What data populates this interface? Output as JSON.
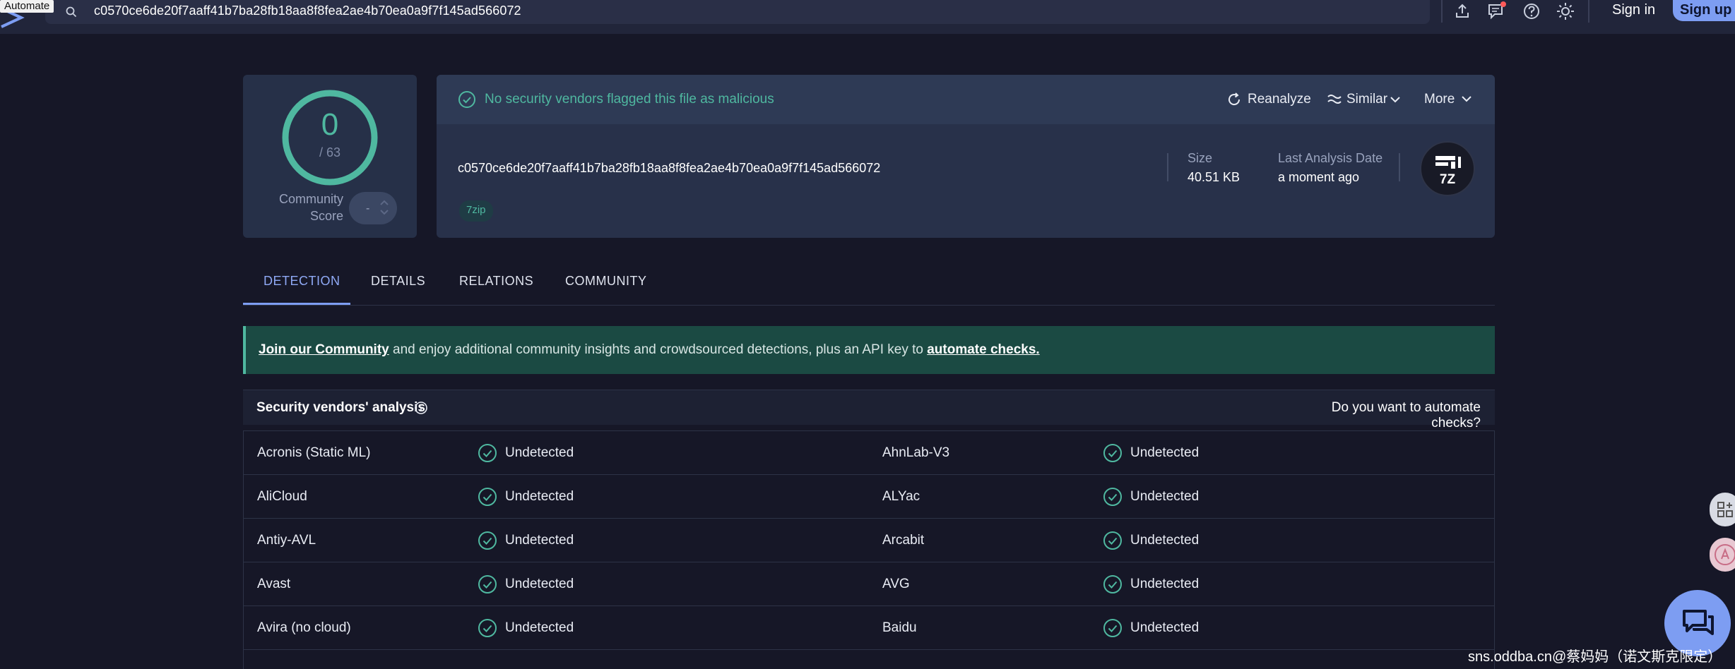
{
  "topbar": {
    "automate_tag": "Automate",
    "search_value": "c0570ce6de20f7aaff41b7ba28fb18aa8f8fea2ae4b70ea0a9f7f145ad566072",
    "signin_label": "Sign in",
    "signup_label": "Sign up"
  },
  "score": {
    "value": "0",
    "total": "/ 63",
    "community_label_line1": "Community",
    "community_label_line2": "Score",
    "community_value": "-"
  },
  "header": {
    "status_text": "No security vendors flagged this file as malicious",
    "reanalyze_label": "Reanalyze",
    "similar_label": "Similar",
    "more_label": "More",
    "file_hash": "c0570ce6de20f7aaff41b7ba28fb18aa8f8fea2ae4b70ea0a9f7f145ad566072",
    "tag": "7zip",
    "size_label": "Size",
    "size_value": "40.51 KB",
    "date_label": "Last Analysis Date",
    "date_value": "a moment ago",
    "file_type_icon_text": "7Z"
  },
  "tabs": [
    {
      "label": "DETECTION",
      "active": true
    },
    {
      "label": "DETAILS",
      "active": false
    },
    {
      "label": "RELATIONS",
      "active": false
    },
    {
      "label": "COMMUNITY",
      "active": false
    }
  ],
  "banner": {
    "link1": "Join our Community",
    "middle": " and enjoy additional community insights and crowdsourced detections, plus an API key to ",
    "link2": "automate checks."
  },
  "vendors": {
    "title": "Security vendors' analysis",
    "automate_question": "Do you want to automate checks?",
    "rows": [
      {
        "left_name": "Acronis (Static ML)",
        "left_result": "Undetected",
        "right_name": "AhnLab-V3",
        "right_result": "Undetected"
      },
      {
        "left_name": "AliCloud",
        "left_result": "Undetected",
        "right_name": "ALYac",
        "right_result": "Undetected"
      },
      {
        "left_name": "Antiy-AVL",
        "left_result": "Undetected",
        "right_name": "Arcabit",
        "right_result": "Undetected"
      },
      {
        "left_name": "Avast",
        "left_result": "Undetected",
        "right_name": "AVG",
        "right_result": "Undetected"
      },
      {
        "left_name": "Avira (no cloud)",
        "left_result": "Undetected",
        "right_name": "Baidu",
        "right_result": "Undetected"
      }
    ]
  },
  "watermark": "sns.oddba.cn@蔡妈妈（诺文斯克限定）",
  "colors": {
    "background": "#161727",
    "accent_green": "#4fb8a0",
    "accent_blue": "#7d9df2",
    "card": "#28314a"
  }
}
